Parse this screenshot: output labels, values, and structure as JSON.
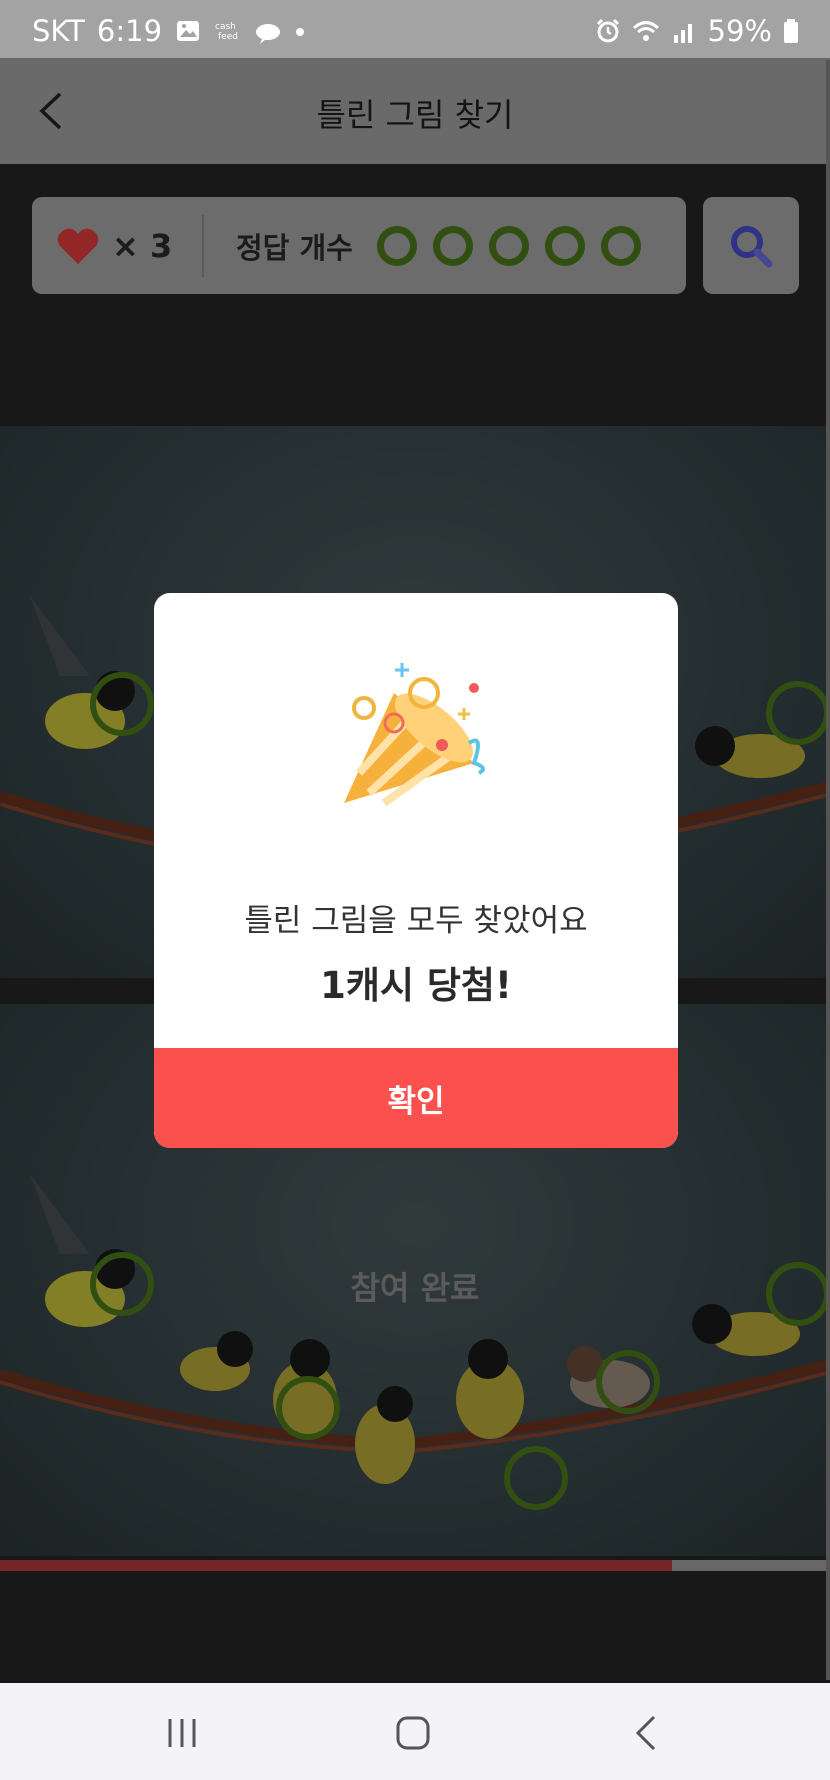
{
  "status_bar": {
    "carrier": "SKT",
    "time": "6:19",
    "battery": "59%",
    "icons": [
      "gallery-icon",
      "cashfeed-icon",
      "cloud-icon",
      "dot-icon",
      "alarm-icon",
      "wifi-icon",
      "signal-icon",
      "battery-icon"
    ]
  },
  "header": {
    "title": "틀린 그림 찾기",
    "back_icon": "chevron-left-icon"
  },
  "game_info": {
    "lives_icon": "heart-icon",
    "lives_count": "× 3",
    "answers_label": "정답 개수",
    "answer_slots_found": 5,
    "answer_slots_total": 5,
    "hint_icon": "search-icon"
  },
  "picture": {
    "done_label": "참여 완료",
    "progress": 0.81
  },
  "modal": {
    "icon": "party-popper-icon",
    "message": "틀린 그림을 모두 찾았어요",
    "prize": "1캐시 당첨!",
    "confirm_label": "확인"
  },
  "nav_bar": {
    "items": [
      "recent-apps-icon",
      "home-icon",
      "back-icon"
    ]
  },
  "colors": {
    "accent_red": "#fa504e",
    "found_green": "#4e7a1c",
    "heart": "#e23b3b",
    "search": "#4b4fc9"
  }
}
